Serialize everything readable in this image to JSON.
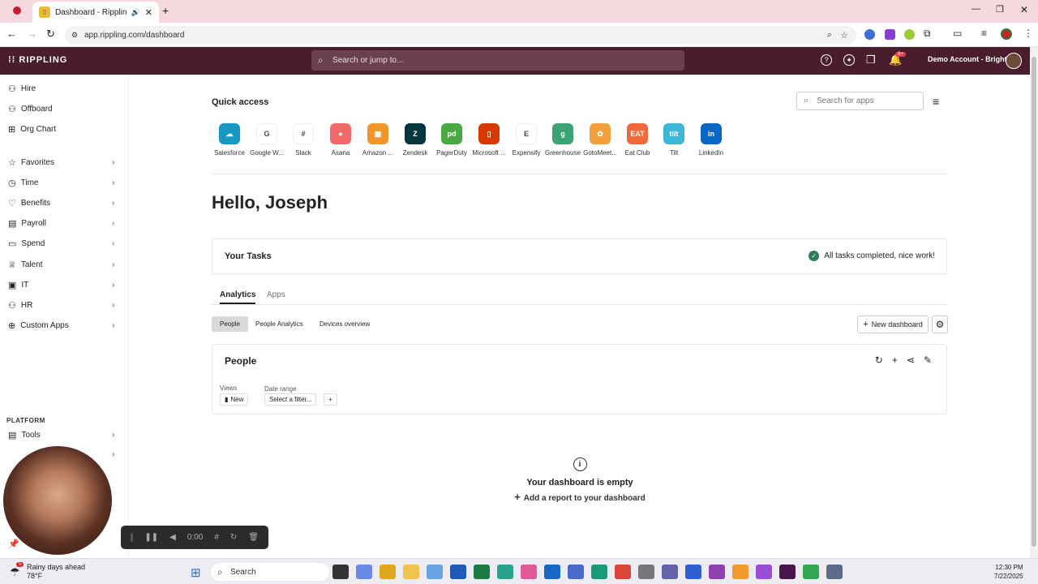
{
  "browser": {
    "tab_title": "Dashboard - Rippling",
    "url": "app.rippling.com/dashboard"
  },
  "topbar": {
    "logo": "⁞⁞ RIPPLING",
    "search_placeholder": "Search or jump to...",
    "notifications_badge": "9+",
    "account": "Demo Account - Bright ..."
  },
  "sidebar": {
    "items": [
      {
        "label": "Hire",
        "icon": "person-add-icon"
      },
      {
        "label": "Offboard",
        "icon": "person-remove-icon"
      },
      {
        "label": "Org Chart",
        "icon": "org-chart-icon"
      },
      {
        "label": "Favorites",
        "icon": "star-icon"
      },
      {
        "label": "Time",
        "icon": "clock-icon"
      },
      {
        "label": "Benefits",
        "icon": "heart-icon"
      },
      {
        "label": "Payroll",
        "icon": "payroll-icon"
      },
      {
        "label": "Spend",
        "icon": "card-icon"
      },
      {
        "label": "Talent",
        "icon": "trophy-icon"
      },
      {
        "label": "IT",
        "icon": "monitor-icon"
      },
      {
        "label": "HR",
        "icon": "people-icon"
      },
      {
        "label": "Custom Apps",
        "icon": "apps-icon"
      }
    ],
    "platform_heading": "PLATFORM",
    "tools": "Tools"
  },
  "quick_access": {
    "title": "Quick access",
    "search_placeholder": "Search for apps",
    "apps": [
      {
        "label": "Salesforce",
        "color": "#1798c1",
        "glyph": "☁"
      },
      {
        "label": "Google W...",
        "color": "#ffffff",
        "glyph": "G"
      },
      {
        "label": "Slack",
        "color": "#ffffff",
        "glyph": "#"
      },
      {
        "label": "Asana",
        "color": "#f06a6a",
        "glyph": "●"
      },
      {
        "label": "Amazon ...",
        "color": "#f0962b",
        "glyph": "▦"
      },
      {
        "label": "Zendesk",
        "color": "#03363d",
        "glyph": "Z"
      },
      {
        "label": "PagerDuty",
        "color": "#49a942",
        "glyph": "pd"
      },
      {
        "label": "Microsoft ...",
        "color": "#d83b01",
        "glyph": "▯"
      },
      {
        "label": "Expensify",
        "color": "#ffffff",
        "glyph": "E"
      },
      {
        "label": "Greenhouse",
        "color": "#3ba374",
        "glyph": "g"
      },
      {
        "label": "GotoMeet...",
        "color": "#f2a03b",
        "glyph": "✿"
      },
      {
        "label": "Eat Club",
        "color": "#ef6a3a",
        "glyph": "EAT"
      },
      {
        "label": "Tilt",
        "color": "#3cb8d6",
        "glyph": "tilt"
      },
      {
        "label": "LinkedIn",
        "color": "#0a66c2",
        "glyph": "in"
      }
    ]
  },
  "greeting": "Hello, Joseph",
  "tasks": {
    "title": "Your Tasks",
    "status": "All tasks completed, nice work!"
  },
  "tabs": [
    "Analytics",
    "Apps"
  ],
  "subtabs": [
    "People",
    "People Analytics",
    "Devices overview"
  ],
  "new_dashboard": "New dashboard",
  "people_card": {
    "title": "People",
    "views_label": "Views",
    "new_label": "New",
    "date_range_label": "Date range",
    "filter_placeholder": "Select a filter..."
  },
  "empty": {
    "title": "Your dashboard is empty",
    "action": "Add a report to your dashboard"
  },
  "recorder": {
    "time": "0:00"
  },
  "taskbar": {
    "weather_line1": "Rainy days ahead",
    "weather_line2": "78°F",
    "weather_badge": "5",
    "search": "Search",
    "time": "12:30 PM",
    "date": "7/22/2025"
  }
}
